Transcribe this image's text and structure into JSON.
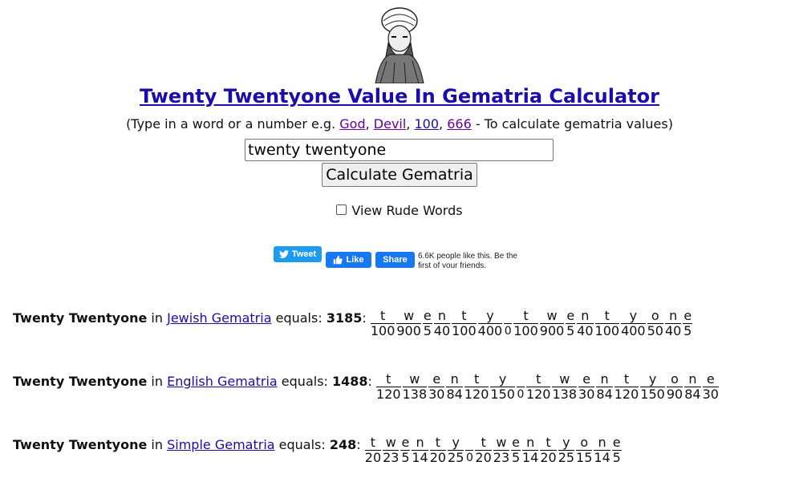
{
  "title": "Twenty Twentyone Value In Gematria Calculator",
  "subtitle": {
    "prefix": "(Type in a word or a number e.g.",
    "examples": [
      "God",
      "Devil",
      "100",
      "666"
    ],
    "suffix": "- To calculate gematria values)"
  },
  "search": {
    "value": "twenty twentyone"
  },
  "calculate_label": "Calculate Gematria",
  "rude_label": "View Rude Words",
  "social": {
    "tweet_label": "Tweet",
    "like_label": "Like",
    "share_label": "Share",
    "fb_text": "6.6K people like this. Be the first of your friends."
  },
  "results": [
    {
      "phrase": "Twenty Twentyone",
      "in": "in",
      "system": "Jewish Gematria",
      "equals": "equals:",
      "total": "3185",
      "letters": [
        {
          "ch": "t",
          "v": "100"
        },
        {
          "ch": "w",
          "v": "900"
        },
        {
          "ch": "e",
          "v": "5"
        },
        {
          "ch": "n",
          "v": "40"
        },
        {
          "ch": "t",
          "v": "100"
        },
        {
          "ch": "y",
          "v": "400"
        },
        {
          "ch": "_",
          "v": "0"
        },
        {
          "ch": "t",
          "v": "100"
        },
        {
          "ch": "w",
          "v": "900"
        },
        {
          "ch": "e",
          "v": "5"
        },
        {
          "ch": "n",
          "v": "40"
        },
        {
          "ch": "t",
          "v": "100"
        },
        {
          "ch": "y",
          "v": "400"
        },
        {
          "ch": "o",
          "v": "50"
        },
        {
          "ch": "n",
          "v": "40"
        },
        {
          "ch": "e",
          "v": "5"
        }
      ]
    },
    {
      "phrase": "Twenty Twentyone",
      "in": "in",
      "system": "English Gematria",
      "equals": "equals:",
      "total": "1488",
      "letters": [
        {
          "ch": "t",
          "v": "120"
        },
        {
          "ch": "w",
          "v": "138"
        },
        {
          "ch": "e",
          "v": "30"
        },
        {
          "ch": "n",
          "v": "84"
        },
        {
          "ch": "t",
          "v": "120"
        },
        {
          "ch": "y",
          "v": "150"
        },
        {
          "ch": "_",
          "v": "0"
        },
        {
          "ch": "t",
          "v": "120"
        },
        {
          "ch": "w",
          "v": "138"
        },
        {
          "ch": "e",
          "v": "30"
        },
        {
          "ch": "n",
          "v": "84"
        },
        {
          "ch": "t",
          "v": "120"
        },
        {
          "ch": "y",
          "v": "150"
        },
        {
          "ch": "o",
          "v": "90"
        },
        {
          "ch": "n",
          "v": "84"
        },
        {
          "ch": "e",
          "v": "30"
        }
      ]
    },
    {
      "phrase": "Twenty Twentyone",
      "in": "in",
      "system": "Simple Gematria",
      "equals": "equals:",
      "total": "248",
      "letters": [
        {
          "ch": "t",
          "v": "20"
        },
        {
          "ch": "w",
          "v": "23"
        },
        {
          "ch": "e",
          "v": "5"
        },
        {
          "ch": "n",
          "v": "14"
        },
        {
          "ch": "t",
          "v": "20"
        },
        {
          "ch": "y",
          "v": "25"
        },
        {
          "ch": "_",
          "v": "0"
        },
        {
          "ch": "t",
          "v": "20"
        },
        {
          "ch": "w",
          "v": "23"
        },
        {
          "ch": "e",
          "v": "5"
        },
        {
          "ch": "n",
          "v": "14"
        },
        {
          "ch": "t",
          "v": "20"
        },
        {
          "ch": "y",
          "v": "25"
        },
        {
          "ch": "o",
          "v": "15"
        },
        {
          "ch": "n",
          "v": "14"
        },
        {
          "ch": "e",
          "v": "5"
        }
      ]
    }
  ],
  "colors": {
    "link": "#1a0dab",
    "visited": "#660099",
    "tweet": "#1d9bf0",
    "facebook": "#1877f2"
  }
}
